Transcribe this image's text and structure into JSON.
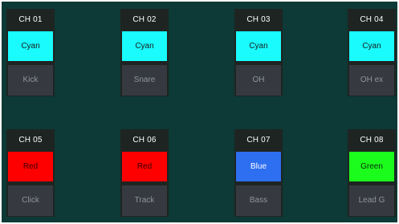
{
  "channels": [
    {
      "label": "CH 01",
      "color_name": "Cyan",
      "color": "#19fbfd",
      "text_color": "#1a1a1a",
      "name": "Kick"
    },
    {
      "label": "CH 02",
      "color_name": "Cyan",
      "color": "#19fbfd",
      "text_color": "#1a1a1a",
      "name": "Snare"
    },
    {
      "label": "CH 03",
      "color_name": "Cyan",
      "color": "#19fbfd",
      "text_color": "#1a1a1a",
      "name": "OH"
    },
    {
      "label": "CH 04",
      "color_name": "Cyan",
      "color": "#19fbfd",
      "text_color": "#1a1a1a",
      "name": "OH ex"
    },
    {
      "label": "CH 05",
      "color_name": "Red",
      "color": "#ff0000",
      "text_color": "#3a0000",
      "name": "Click"
    },
    {
      "label": "CH 06",
      "color_name": "Red",
      "color": "#ff0000",
      "text_color": "#3a0000",
      "name": "Track"
    },
    {
      "label": "CH 07",
      "color_name": "Blue",
      "color": "#2d6ff0",
      "text_color": "#ffffff",
      "name": "Bass"
    },
    {
      "label": "CH 08",
      "color_name": "Green",
      "color": "#1cfc1c",
      "text_color": "#0c2a0c",
      "name": "Lead G"
    }
  ],
  "colors": {
    "background": "#0d3a36",
    "strip": "#1e2422",
    "name_button": "#363a40",
    "name_text": "#8f949a"
  }
}
